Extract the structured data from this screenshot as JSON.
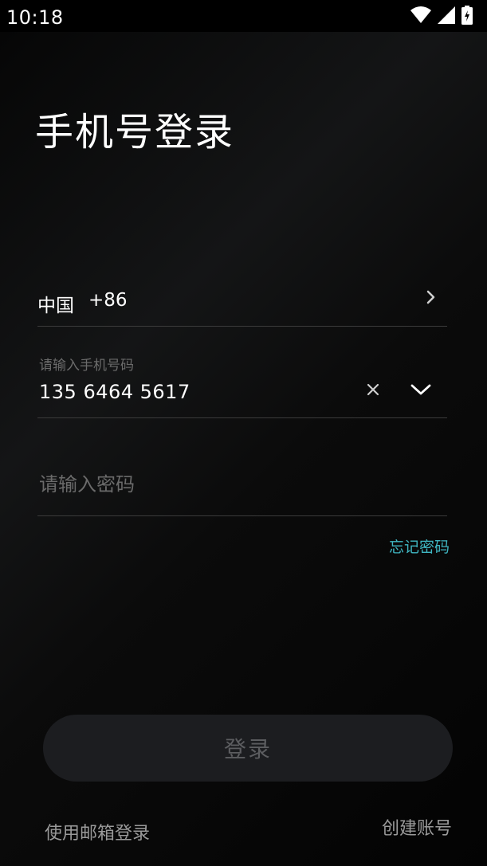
{
  "status_bar": {
    "time": "10:18",
    "icons": [
      "wifi-icon",
      "cell-signal-icon",
      "battery-charging-icon"
    ]
  },
  "page": {
    "title": "手机号登录"
  },
  "country": {
    "name": "中国",
    "code": "+86",
    "icon": "chevron-right-icon"
  },
  "phone": {
    "label": "请输入手机号码",
    "value": "135 6464 5617",
    "clear_icon": "close-icon",
    "dropdown_icon": "chevron-down-icon"
  },
  "password": {
    "placeholder": "请输入密码",
    "value": ""
  },
  "forgot_password": "忘记密码",
  "login_button": "登录",
  "footer": {
    "email_login": "使用邮箱登录",
    "create_account": "创建账号"
  },
  "colors": {
    "accent": "#3fb6c2",
    "background": "#000000",
    "button_bg": "#1c1d20",
    "button_text_disabled": "#5c5d60"
  }
}
